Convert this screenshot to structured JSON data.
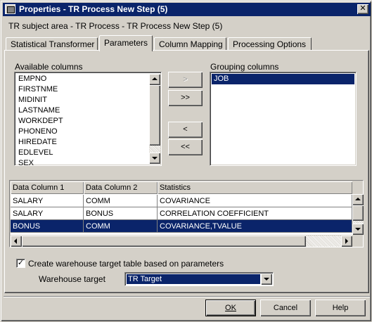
{
  "window": {
    "title": "Properties - TR Process New Step (5)",
    "close_glyph": "✕"
  },
  "subject_area": "TR subject area - TR Process - TR Process New Step (5)",
  "tabs": [
    {
      "label": "Statistical Transformer",
      "active": false
    },
    {
      "label": "Parameters",
      "active": true
    },
    {
      "label": "Column Mapping",
      "active": false
    },
    {
      "label": "Processing Options",
      "active": false
    }
  ],
  "available": {
    "label": "Available columns",
    "items": [
      "EMPNO",
      "FIRSTNME",
      "MIDINIT",
      "LASTNAME",
      "WORKDEPT",
      "PHONENO",
      "HIREDATE",
      "EDLEVEL",
      "SEX"
    ]
  },
  "grouping": {
    "label": "Grouping columns",
    "items": [
      "JOB"
    ]
  },
  "move_buttons": {
    "add": ">",
    "add_all": ">>",
    "remove": "<",
    "remove_all": "<<"
  },
  "grid": {
    "headers": [
      "Data Column 1",
      "Data Column 2",
      "Statistics"
    ],
    "rows": [
      [
        "SALARY",
        "COMM",
        "COVARIANCE"
      ],
      [
        "SALARY",
        "BONUS",
        "CORRELATION COEFFICIENT"
      ],
      [
        "BONUS",
        "COMM",
        "COVARIANCE,TVALUE"
      ]
    ],
    "selected_row": 2
  },
  "create_table": {
    "label": "Create warehouse target table based on parameters",
    "checked_glyph": "✓"
  },
  "warehouse_target": {
    "label": "Warehouse target",
    "value": "TR Target"
  },
  "footer": {
    "ok": "OK",
    "cancel": "Cancel",
    "help": "Help"
  },
  "colors": {
    "face": "#d4d0c8",
    "selection": "#0a246a",
    "titlebar": "#0a246a"
  }
}
